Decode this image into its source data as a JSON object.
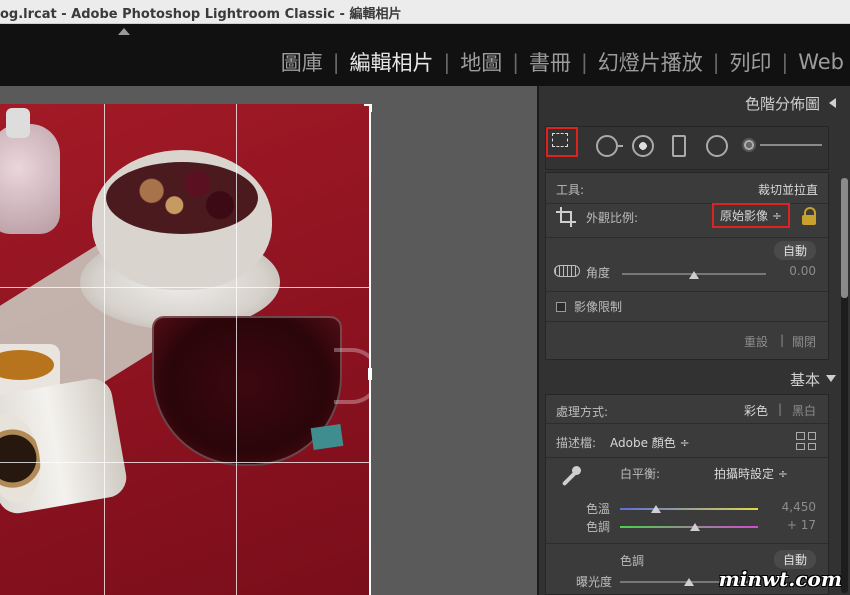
{
  "window": {
    "title": "og.lrcat - Adobe Photoshop Lightroom Classic - 編輯相片"
  },
  "modules": [
    {
      "label": "圖庫",
      "active": false
    },
    {
      "label": "編輯相片",
      "active": true
    },
    {
      "label": "地圖",
      "active": false
    },
    {
      "label": "書冊",
      "active": false
    },
    {
      "label": "幻燈片播放",
      "active": false
    },
    {
      "label": "列印",
      "active": false
    },
    {
      "label": "Web",
      "active": false
    }
  ],
  "module_separator": "|",
  "histogram": {
    "title": "色階分佈圖"
  },
  "crop_panel": {
    "tool_label": "工具:",
    "tool_value": "裁切並拉直",
    "aspect_label": "外觀比例:",
    "aspect_value": "原始影像 ÷",
    "auto_label": "自動",
    "angle_label": "角度",
    "angle_value": "0.00",
    "angle_position": 0.5,
    "constrain_label": "影像限制",
    "constrain_checked": false,
    "reset_label": "重設",
    "close_label": "關閉",
    "separator": "|"
  },
  "basic_panel": {
    "title": "基本",
    "treatment_label": "處理方式:",
    "color_label": "彩色",
    "bw_label": "黑白",
    "separator": "|",
    "profile_label": "描述檔:",
    "profile_value": "Adobe 顏色 ÷",
    "wb_label": "白平衡:",
    "wb_value": "拍攝時設定 ÷",
    "temp_label": "色溫",
    "temp_value": "4,450",
    "temp_position": 0.26,
    "tint_label": "色調",
    "tint_value": "+ 17",
    "tint_position": 0.54,
    "tone_label": "色調",
    "tone_auto": "自動",
    "exposure_label": "曝光度",
    "exposure_position": 0.5
  },
  "watermark": "minwt.com",
  "colors": {
    "highlight_red": "#d22222",
    "accent_lock": "#c8a22c"
  }
}
